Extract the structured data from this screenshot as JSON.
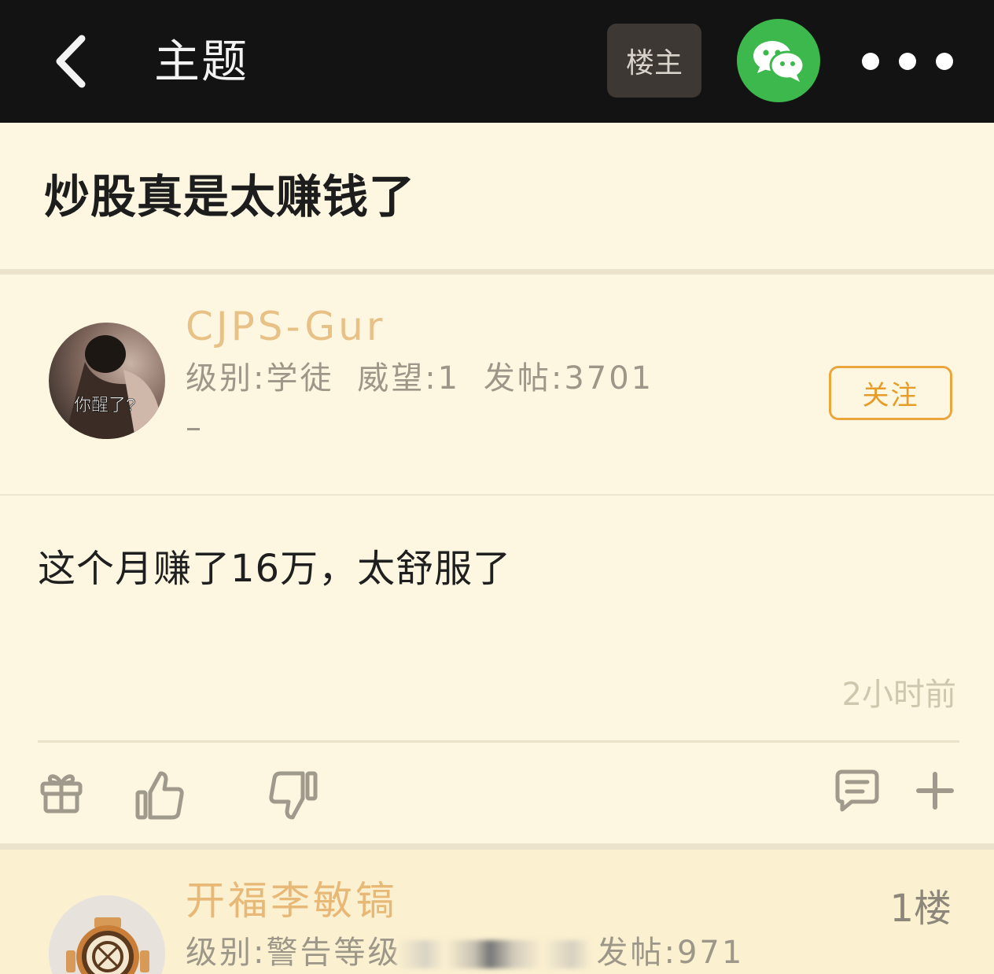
{
  "topbar": {
    "title": "主题",
    "op_label": "楼主",
    "back_icon": "chevron-left-icon",
    "share_icon": "wechat-icon",
    "more_icon": "more-dots-icon"
  },
  "thread": {
    "title": "炒股真是太赚钱了"
  },
  "post": {
    "username": "CJPS-Gur",
    "avatar_caption": "你醒了?",
    "level": "级别:学徒",
    "prestige": "威望:1",
    "posts": "发帖:3701",
    "follow_label": "关注",
    "content": "这个月赚了16万，太舒服了",
    "time": "2小时前",
    "actions": [
      "gift-icon",
      "thumbs-up-icon",
      "thumbs-down-icon",
      "comment-icon",
      "plus-icon"
    ]
  },
  "reply": {
    "username": "开福李敏镐",
    "floor": "1楼",
    "level": "级别:警告等级",
    "posts": "发帖:971"
  },
  "colors": {
    "topbar_bg": "#131313",
    "page_bg": "#fdf7e2",
    "username": "#e8c187",
    "follow_accent": "#eaa63c",
    "wechat_green": "#3cb84d"
  }
}
